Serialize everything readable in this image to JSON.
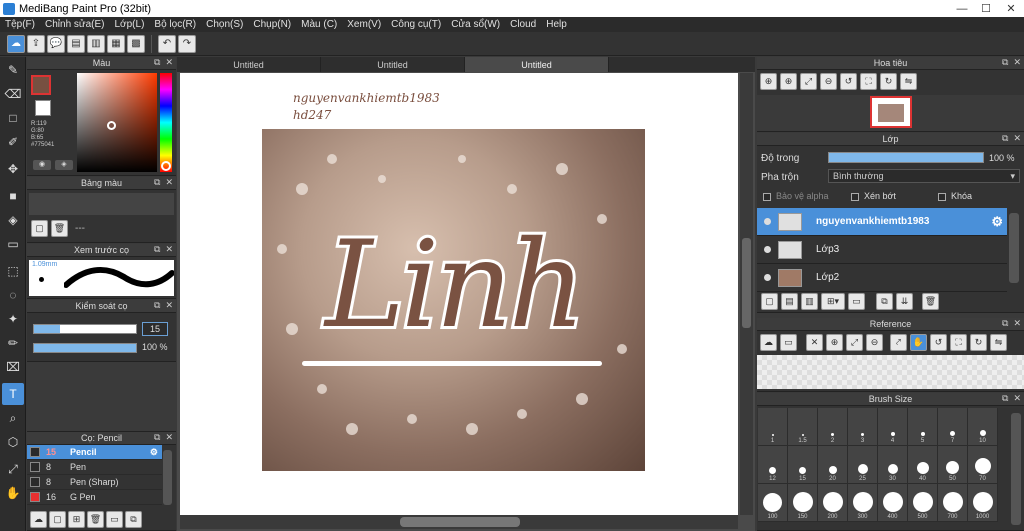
{
  "window": {
    "title": "MediBang Paint Pro (32bit)"
  },
  "menu": [
    "Tệp(F)",
    "Chỉnh sửa(E)",
    "Lớp(L)",
    "Bộ lọc(R)",
    "Chọn(S)",
    "Chụp(N)",
    "Màu (C)",
    "Xem(V)",
    "Công cụ(T)",
    "Cửa sổ(W)",
    "Cloud",
    "Help"
  ],
  "toolbar_icons": [
    "cloud-save-icon",
    "export-icon",
    "comment-icon",
    "page-icon",
    "page-icon-2",
    "grid-icon",
    "panel-icon",
    "undo-icon",
    "redo-icon"
  ],
  "color_panel": {
    "title": "Màu",
    "readout": {
      "r": "R:119",
      "g": "G:80",
      "b": "B:65",
      "hex": "#775041"
    },
    "current_color": "#775041"
  },
  "palette_panel": {
    "title": "Bảng màu",
    "placeholder": "---"
  },
  "brush_preview": {
    "title": "Xem trước cọ",
    "size": "1.09mm"
  },
  "brush_control": {
    "title": "Kiểm soát cọ",
    "size_value": "15",
    "opacity_value": "100 %",
    "opacity": 1.0,
    "size_fraction": 0.25
  },
  "brush_list": {
    "title": "Cọ: Pencil",
    "items": [
      {
        "size": "15",
        "name": "Pencil",
        "selected": true,
        "color": "#2a2a2a"
      },
      {
        "size": "8",
        "name": "Pen",
        "selected": false,
        "color": "#2a2a2a"
      },
      {
        "size": "8",
        "name": "Pen (Sharp)",
        "selected": false,
        "color": "#2a2a2a"
      },
      {
        "size": "16",
        "name": "G Pen",
        "selected": false,
        "color": "#e83030"
      }
    ]
  },
  "tabs": [
    "Untitled",
    "Untitled",
    "Untitled"
  ],
  "canvas": {
    "watermark_line1": "nguyenvankhiemtb1983",
    "watermark_line2": "hd247",
    "lettering": "Linh"
  },
  "navigator": {
    "title": "Hoa tiêu"
  },
  "layers_panel": {
    "title": "Lớp",
    "opacity_label": "Độ trong",
    "opacity_value": "100 %",
    "blend_label": "Pha trộn",
    "blend_value": "Bình thường",
    "protect_alpha": "Bảo vệ alpha",
    "clipping": "Xén bớt",
    "lock": "Khóa",
    "layers": [
      {
        "name": "nguyenvankhiemtb1983",
        "selected": true
      },
      {
        "name": "Lớp3",
        "selected": false
      },
      {
        "name": "Lớp2",
        "selected": false
      }
    ]
  },
  "reference_panel": {
    "title": "Reference"
  },
  "brush_size_panel": {
    "title": "Brush Size",
    "sizes": [
      "1",
      "1.5",
      "2",
      "3",
      "4",
      "5",
      "7",
      "10",
      "12",
      "15",
      "20",
      "25",
      "30",
      "40",
      "50",
      "70",
      "100",
      "150",
      "200",
      "300",
      "400",
      "500",
      "700",
      "1000"
    ]
  }
}
